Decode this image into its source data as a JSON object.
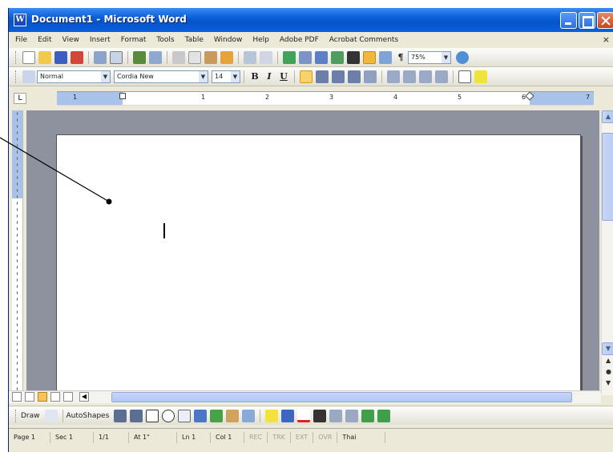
{
  "window": {
    "title": "Document1 - Microsoft Word",
    "app_icon_letter": "W"
  },
  "menubar": {
    "items": [
      "File",
      "Edit",
      "View",
      "Insert",
      "Format",
      "Tools",
      "Table",
      "Window",
      "Help",
      "Adobe PDF",
      "Acrobat Comments"
    ],
    "close_glyph": "×"
  },
  "standard_toolbar": {
    "zoom_value": "75%"
  },
  "formatting_toolbar": {
    "style_value": "Normal",
    "font_value": "Cordia New",
    "size_value": "14",
    "bold_label": "B",
    "italic_label": "I",
    "underline_label": "U"
  },
  "ruler": {
    "tab_selector": "L",
    "numbers": [
      "1",
      "1",
      "2",
      "3",
      "4",
      "5",
      "6",
      "7"
    ]
  },
  "drawing_toolbar": {
    "draw_label": "Draw",
    "autoshapes_label": "AutoShapes"
  },
  "statusbar": {
    "page": "Page 1",
    "section": "Sec 1",
    "page_of": "1/1",
    "at": "At 1\"",
    "line": "Ln 1",
    "col": "Col 1",
    "rec": "REC",
    "trk": "TRK",
    "ext": "EXT",
    "ovr": "OVR",
    "language": "Thai"
  },
  "colors": {
    "titlebar": "#0553c9",
    "toolbar_bg": "#ece9d8",
    "doc_gray": "#8d929e",
    "accent_blue": "#a9c2ea"
  }
}
